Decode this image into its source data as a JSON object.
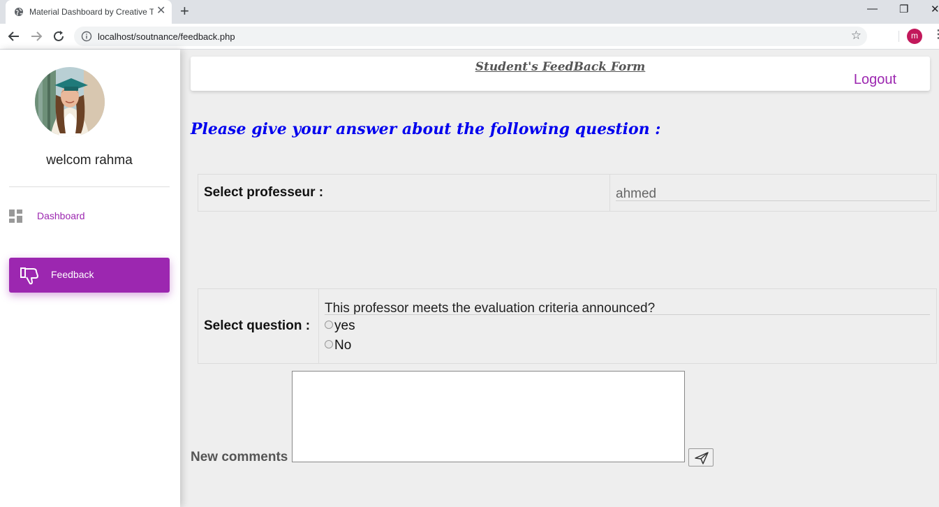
{
  "browser": {
    "tab_title": "Material Dashboard by Creative Tim",
    "tab_close": "✕",
    "new_tab": "+",
    "url": "localhost/soutnance/feedback.php",
    "profile_initial": "m",
    "minimize": "—",
    "maximize": "❐",
    "close": "✕"
  },
  "sidebar": {
    "welcome": "welcom rahma",
    "items": [
      {
        "label": "Dashboard",
        "icon": "dashboard-icon",
        "active": false
      },
      {
        "label": "Feedback",
        "icon": "thumb-down-icon",
        "active": true
      }
    ]
  },
  "header": {
    "title": "Student's FeedBack Form",
    "logout": "Logout"
  },
  "main": {
    "prompt": "Please give your answer about the following question :",
    "professor_label": "Select professeur :",
    "professor_value": "ahmed",
    "question_label": "Select question :",
    "question_value": "This professor meets the evaluation criteria announced?",
    "options": [
      "yes",
      "No"
    ],
    "comments_label": "New comments",
    "comments_value": ""
  },
  "colors": {
    "accent": "#9c27b0",
    "prompt": "#0000ee",
    "background": "#eeeeee"
  }
}
